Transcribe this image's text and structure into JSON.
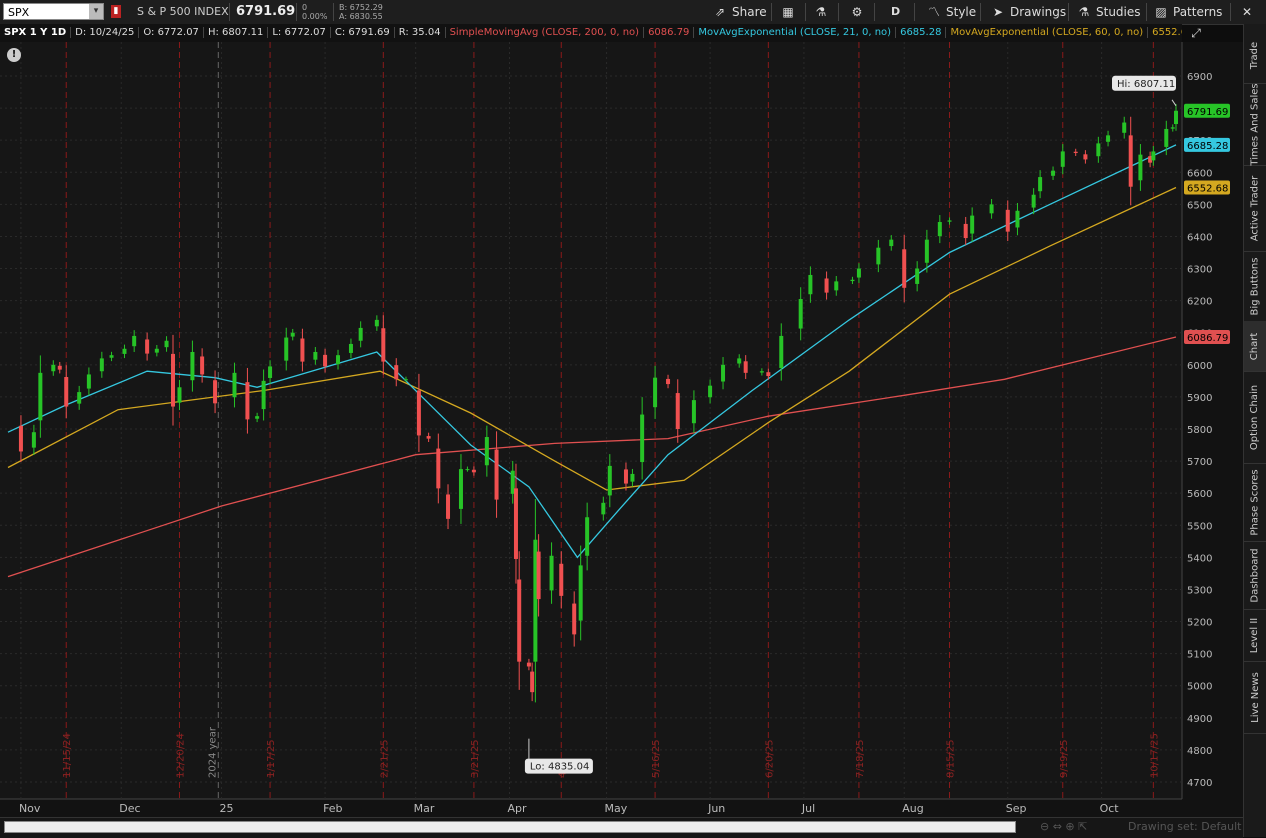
{
  "topbar": {
    "symbol": "SPX",
    "description": "S & P 500 INDEX",
    "last_price": "6791.69",
    "change": "0",
    "change_pct": "0.00%",
    "bid": "B: 6752.29",
    "ask": "A: 6830.55",
    "share_label": "Share",
    "aggregation_label": "D",
    "style_label": "Style",
    "drawings_label": "Drawings",
    "studies_label": "Studies",
    "patterns_label": "Patterns"
  },
  "infobar": {
    "chart_label": "SPX 1 Y 1D",
    "date": "D: 10/24/25",
    "open": "O: 6772.07",
    "high": "H: 6807.11",
    "low": "L: 6772.07",
    "close": "C: 6791.69",
    "range": "R: 35.04",
    "sma_label": "SimpleMovingAvg (CLOSE, 200, 0, no)",
    "sma_value": "6086.79",
    "ema21_label": "MovAvgExponential (CLOSE, 21, 0, no)",
    "ema21_value": "6685.28",
    "ema60_label": "MovAvgExponential (CLOSE, 60, 0, no)",
    "ema60_value": "6552.68"
  },
  "right_tabs": [
    "Trade",
    "Times And Sales",
    "Active Trader",
    "Big Buttons",
    "Chart",
    "Option Chain",
    "Phase Scores",
    "Dashboard",
    "Level II",
    "Live News"
  ],
  "bottom": {
    "drawing_set": "Drawing set: Default"
  },
  "colors": {
    "up": "#27c427",
    "down": "#f05050",
    "sma200": "#e05050",
    "ema21": "#35c8e0",
    "ema60": "#d4a820",
    "event_line": "#8a1a1a"
  },
  "chart_data": {
    "type": "candlestick",
    "symbol": "SPX",
    "ylim": [
      4650,
      6980
    ],
    "y_ticks": [
      4700,
      4800,
      4900,
      5000,
      5100,
      5200,
      5300,
      5400,
      5500,
      5600,
      5700,
      5800,
      5900,
      6000,
      6100,
      6200,
      6300,
      6400,
      6500,
      6600,
      6700,
      6800,
      6900
    ],
    "month_labels": [
      {
        "label": "Nov",
        "date": "2024-11-01"
      },
      {
        "label": "Dec",
        "date": "2024-12-02"
      },
      {
        "label": "25",
        "date": "2025-01-02"
      },
      {
        "label": "Feb",
        "date": "2025-02-03"
      },
      {
        "label": "Mar",
        "date": "2025-03-03"
      },
      {
        "label": "Apr",
        "date": "2025-04-01"
      },
      {
        "label": "May",
        "date": "2025-05-01"
      },
      {
        "label": "Jun",
        "date": "2025-06-02"
      },
      {
        "label": "Jul",
        "date": "2025-07-01"
      },
      {
        "label": "Aug",
        "date": "2025-08-01"
      },
      {
        "label": "Sep",
        "date": "2025-09-02"
      },
      {
        "label": "Oct",
        "date": "2025-10-01"
      }
    ],
    "event_lines": [
      {
        "label": "11/15/24",
        "date": "2024-11-15"
      },
      {
        "label": "12/20/24",
        "date": "2024-12-20"
      },
      {
        "label": "1/17/25",
        "date": "2025-01-17"
      },
      {
        "label": "2/21/25",
        "date": "2025-02-21"
      },
      {
        "label": "3/21/25",
        "date": "2025-03-21"
      },
      {
        "label": "4/",
        "date": "2025-04-17"
      },
      {
        "label": "5/16/25",
        "date": "2025-05-16"
      },
      {
        "label": "6/20/25",
        "date": "2025-06-20"
      },
      {
        "label": "7/18/25",
        "date": "2025-07-18"
      },
      {
        "label": "8/15/25",
        "date": "2025-08-15"
      },
      {
        "label": "9/19/25",
        "date": "2025-09-19"
      },
      {
        "label": "10/17/25",
        "date": "2025-10-17"
      }
    ],
    "year_marker": {
      "label": "2024 year",
      "date": "2025-01-01"
    },
    "hi": {
      "label": "Hi: 6807.11",
      "value": 6807.11,
      "date": "2025-10-24"
    },
    "lo": {
      "label": "Lo: 4835.04",
      "value": 4835.04,
      "date": "2025-04-07"
    },
    "price_labels": {
      "last": "6791.69",
      "ema21": "6685.28",
      "ema60": "6552.68",
      "sma200": "6086.79"
    },
    "closes": [
      [
        "2024-10-28",
        5830
      ],
      [
        "2024-11-01",
        5730
      ],
      [
        "2024-11-05",
        5790
      ],
      [
        "2024-11-07",
        5975
      ],
      [
        "2024-11-11",
        6000
      ],
      [
        "2024-11-13",
        5985
      ],
      [
        "2024-11-15",
        5870
      ],
      [
        "2024-11-19",
        5915
      ],
      [
        "2024-11-22",
        5970
      ],
      [
        "2024-11-26",
        6020
      ],
      [
        "2024-11-29",
        6030
      ],
      [
        "2024-12-03",
        6050
      ],
      [
        "2024-12-06",
        6090
      ],
      [
        "2024-12-10",
        6035
      ],
      [
        "2024-12-13",
        6050
      ],
      [
        "2024-12-16",
        6075
      ],
      [
        "2024-12-18",
        5870
      ],
      [
        "2024-12-20",
        5930
      ],
      [
        "2024-12-24",
        6040
      ],
      [
        "2024-12-27",
        5970
      ],
      [
        "2024-12-31",
        5880
      ],
      [
        "2025-01-06",
        5975
      ],
      [
        "2025-01-10",
        5830
      ],
      [
        "2025-01-13",
        5840
      ],
      [
        "2025-01-15",
        5950
      ],
      [
        "2025-01-17",
        5995
      ],
      [
        "2025-01-22",
        6085
      ],
      [
        "2025-01-24",
        6100
      ],
      [
        "2025-01-27",
        6010
      ],
      [
        "2025-01-31",
        6040
      ],
      [
        "2025-02-03",
        5995
      ],
      [
        "2025-02-07",
        6030
      ],
      [
        "2025-02-11",
        6065
      ],
      [
        "2025-02-14",
        6115
      ],
      [
        "2025-02-19",
        6140
      ],
      [
        "2025-02-21",
        6010
      ],
      [
        "2025-02-25",
        5955
      ],
      [
        "2025-02-28",
        5955
      ],
      [
        "2025-03-04",
        5780
      ],
      [
        "2025-03-07",
        5770
      ],
      [
        "2025-03-10",
        5615
      ],
      [
        "2025-03-13",
        5520
      ],
      [
        "2025-03-17",
        5675
      ],
      [
        "2025-03-19",
        5675
      ],
      [
        "2025-03-21",
        5665
      ],
      [
        "2025-03-25",
        5775
      ],
      [
        "2025-03-28",
        5580
      ],
      [
        "2025-04-02",
        5670
      ],
      [
        "2025-04-03",
        5395
      ],
      [
        "2025-04-04",
        5075
      ],
      [
        "2025-04-07",
        5060
      ],
      [
        "2025-04-08",
        4980
      ],
      [
        "2025-04-09",
        5455
      ],
      [
        "2025-04-10",
        5270
      ],
      [
        "2025-04-14",
        5405
      ],
      [
        "2025-04-17",
        5280
      ],
      [
        "2025-04-21",
        5160
      ],
      [
        "2025-04-23",
        5375
      ],
      [
        "2025-04-25",
        5525
      ],
      [
        "2025-04-30",
        5570
      ],
      [
        "2025-05-02",
        5685
      ],
      [
        "2025-05-07",
        5630
      ],
      [
        "2025-05-09",
        5660
      ],
      [
        "2025-05-12",
        5845
      ],
      [
        "2025-05-16",
        5960
      ],
      [
        "2025-05-20",
        5940
      ],
      [
        "2025-05-23",
        5800
      ],
      [
        "2025-05-28",
        5890
      ],
      [
        "2025-06-02",
        5935
      ],
      [
        "2025-06-06",
        6000
      ],
      [
        "2025-06-11",
        6020
      ],
      [
        "2025-06-13",
        5975
      ],
      [
        "2025-06-18",
        5980
      ],
      [
        "2025-06-20",
        5965
      ],
      [
        "2025-06-24",
        6090
      ],
      [
        "2025-06-30",
        6205
      ],
      [
        "2025-07-03",
        6280
      ],
      [
        "2025-07-08",
        6225
      ],
      [
        "2025-07-11",
        6260
      ],
      [
        "2025-07-16",
        6265
      ],
      [
        "2025-07-18",
        6300
      ],
      [
        "2025-07-24",
        6365
      ],
      [
        "2025-07-28",
        6390
      ],
      [
        "2025-08-01",
        6240
      ],
      [
        "2025-08-05",
        6300
      ],
      [
        "2025-08-08",
        6390
      ],
      [
        "2025-08-12",
        6445
      ],
      [
        "2025-08-15",
        6450
      ],
      [
        "2025-08-20",
        6395
      ],
      [
        "2025-08-22",
        6465
      ],
      [
        "2025-08-28",
        6500
      ],
      [
        "2025-09-02",
        6415
      ],
      [
        "2025-09-05",
        6480
      ],
      [
        "2025-09-10",
        6530
      ],
      [
        "2025-09-12",
        6585
      ],
      [
        "2025-09-16",
        6605
      ],
      [
        "2025-09-19",
        6665
      ],
      [
        "2025-09-23",
        6660
      ],
      [
        "2025-09-26",
        6640
      ],
      [
        "2025-09-30",
        6690
      ],
      [
        "2025-10-03",
        6715
      ],
      [
        "2025-10-08",
        6755
      ],
      [
        "2025-10-10",
        6555
      ],
      [
        "2025-10-13",
        6655
      ],
      [
        "2025-10-16",
        6630
      ],
      [
        "2025-10-17",
        6665
      ],
      [
        "2025-10-21",
        6735
      ],
      [
        "2025-10-23",
        6740
      ],
      [
        "2025-10-24",
        6791.69
      ]
    ],
    "sma200": [
      [
        "2024-10-28",
        5340
      ],
      [
        "2025-01-02",
        5560
      ],
      [
        "2025-03-03",
        5720
      ],
      [
        "2025-04-15",
        5755
      ],
      [
        "2025-05-20",
        5770
      ],
      [
        "2025-06-20",
        5840
      ],
      [
        "2025-08-01",
        5905
      ],
      [
        "2025-09-01",
        5955
      ],
      [
        "2025-10-24",
        6086.79
      ]
    ],
    "ema21": [
      [
        "2024-10-28",
        5790
      ],
      [
        "2024-11-15",
        5875
      ],
      [
        "2024-12-10",
        5980
      ],
      [
        "2024-12-31",
        5960
      ],
      [
        "2025-01-13",
        5930
      ],
      [
        "2025-02-19",
        6040
      ],
      [
        "2025-03-05",
        5900
      ],
      [
        "2025-03-20",
        5750
      ],
      [
        "2025-04-07",
        5620
      ],
      [
        "2025-04-22",
        5400
      ],
      [
        "2025-05-05",
        5550
      ],
      [
        "2025-05-20",
        5720
      ],
      [
        "2025-06-15",
        5920
      ],
      [
        "2025-07-15",
        6140
      ],
      [
        "2025-08-15",
        6350
      ],
      [
        "2025-09-15",
        6500
      ],
      [
        "2025-10-24",
        6685.28
      ]
    ],
    "ema60": [
      [
        "2024-10-28",
        5680
      ],
      [
        "2024-12-01",
        5860
      ],
      [
        "2025-01-15",
        5920
      ],
      [
        "2025-02-20",
        5980
      ],
      [
        "2025-03-20",
        5850
      ],
      [
        "2025-04-15",
        5700
      ],
      [
        "2025-05-01",
        5610
      ],
      [
        "2025-05-25",
        5640
      ],
      [
        "2025-06-20",
        5820
      ],
      [
        "2025-07-15",
        5980
      ],
      [
        "2025-08-15",
        6220
      ],
      [
        "2025-09-15",
        6370
      ],
      [
        "2025-10-24",
        6552.68
      ]
    ]
  }
}
